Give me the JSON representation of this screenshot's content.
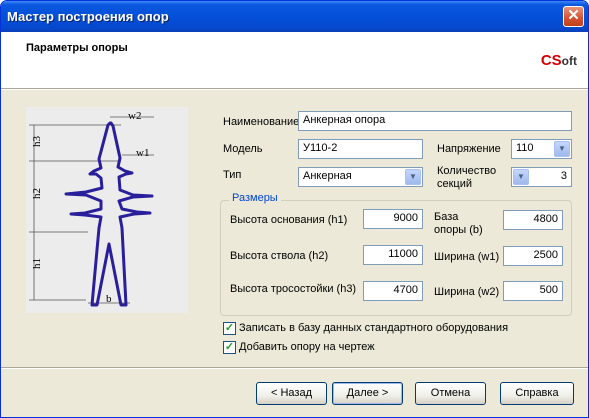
{
  "window": {
    "title": "Мастер построения опор"
  },
  "header": {
    "title": "Параметры опоры",
    "logo_cs": "CS",
    "logo_oft": "oft"
  },
  "tower": {
    "labels": {
      "w2": "w2",
      "w1": "w1",
      "h3": "h3",
      "h2": "h2",
      "h1": "h1",
      "b": "b"
    }
  },
  "form": {
    "name_label": "Наименование",
    "name_value": "Анкерная опора",
    "model_label": "Модель",
    "model_value": "У110-2",
    "voltage_label": "Напряжение",
    "voltage_value": "110",
    "type_label": "Тип",
    "type_value": "Анкерная",
    "sections_label_1": "Количество",
    "sections_label_2": "секций",
    "sections_value": "3"
  },
  "sizes": {
    "legend": "Размеры",
    "h1_label": "Высота основания (h1)",
    "h1_value": "9000",
    "base_label_1": "База",
    "base_label_2": "опоры (b)",
    "base_value": "4800",
    "h2_label": "Высота ствола (h2)",
    "h2_value": "11000",
    "w1_label": "Ширина (w1)",
    "w1_value": "2500",
    "h3_label": "Высота тросостойки (h3)",
    "h3_value": "4700",
    "w2_label": "Ширина (w2)",
    "w2_value": "500"
  },
  "options": {
    "save_db_label": "Записать в базу данных стандартного оборудования",
    "save_db_checked": true,
    "add_drawing_label": "Добавить опору на чертеж",
    "add_drawing_checked": true
  },
  "buttons": {
    "back": "< Назад",
    "next": "Далее >",
    "cancel": "Отмена",
    "help": "Справка"
  },
  "icons": {
    "close": "close-icon",
    "check": "check-icon",
    "dropdown": "chevron-down-icon"
  },
  "colors": {
    "titlebar": "#0450d8",
    "tower": "#2a1f9a",
    "legend": "#0046d5",
    "logo_red": "#d40000"
  }
}
